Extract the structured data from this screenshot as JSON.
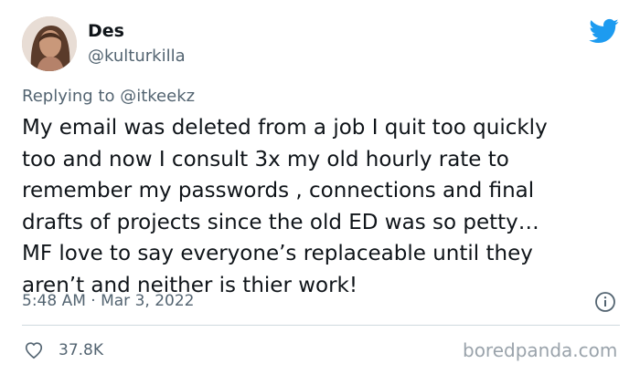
{
  "author": {
    "display_name": "Des",
    "handle": "@kulturkilla"
  },
  "reply": {
    "prefix": "Replying to",
    "mention": "@itkeekz"
  },
  "tweet": {
    "lines": [
      "My email was deleted from a job I quit too quickly",
      "too and now I consult 3x my old hourly rate to",
      "remember my passwords , connections and final",
      "drafts of projects since the old ED was so petty…",
      "MF love to say everyone’s replaceable until they",
      "aren’t and neither is thier work!"
    ],
    "timestamp": "5:48 AM · Mar 3, 2022"
  },
  "stats": {
    "likes": "37.8K"
  },
  "watermark": "boredpanda.com",
  "icons": {
    "brand": "twitter-bird-icon",
    "info": "info-icon",
    "like": "heart-icon"
  },
  "colors": {
    "twitter_blue": "#1d9bf0",
    "secondary_text": "#536471",
    "divider": "#cfd9de"
  }
}
